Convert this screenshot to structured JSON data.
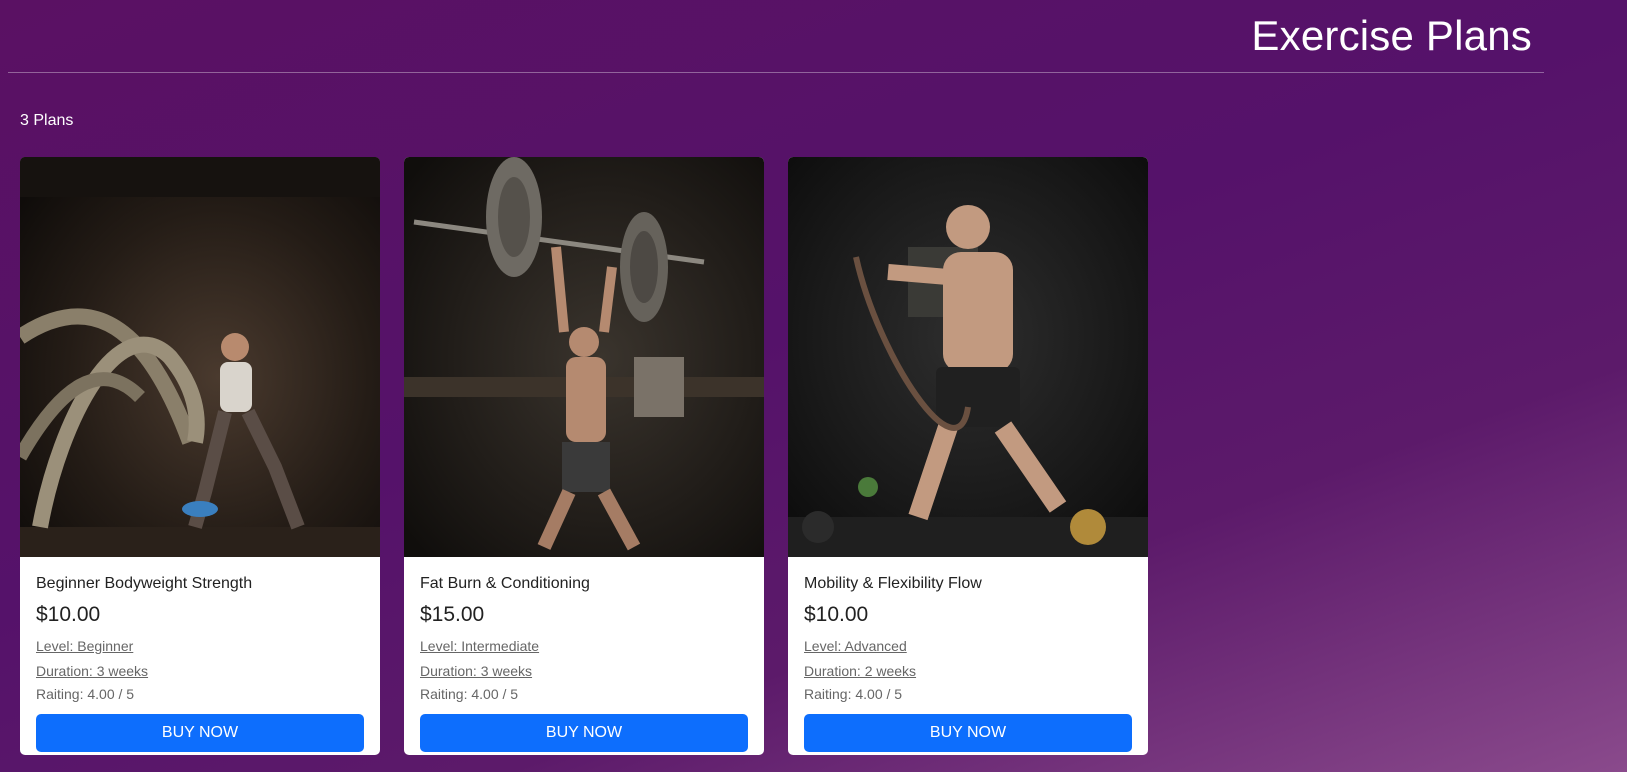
{
  "header": {
    "title": "Exercise Plans"
  },
  "plan_count": "3 Plans",
  "plans": [
    {
      "title": "Beginner Bodyweight Strength",
      "price": "$10.00",
      "level": "Level: Beginner",
      "duration": "Duration: 3 weeks",
      "rating": "Raiting: 4.00 / 5",
      "button": "BUY NOW",
      "image_icon": "battle-ropes-photo"
    },
    {
      "title": "Fat Burn & Conditioning",
      "price": "$15.00",
      "level": "Level: Intermediate",
      "duration": "Duration: 3 weeks",
      "rating": "Raiting: 4.00 / 5",
      "button": "BUY NOW",
      "image_icon": "barbell-overhead-photo"
    },
    {
      "title": "Mobility & Flexibility Flow",
      "price": "$10.00",
      "level": "Level: Advanced",
      "duration": "Duration: 2 weeks",
      "rating": "Raiting: 4.00 / 5",
      "button": "BUY NOW",
      "image_icon": "resistance-band-photo"
    }
  ],
  "colors": {
    "accent": "#0d6efd",
    "background_start": "#5a1163",
    "background_end": "#8a4a8c"
  }
}
